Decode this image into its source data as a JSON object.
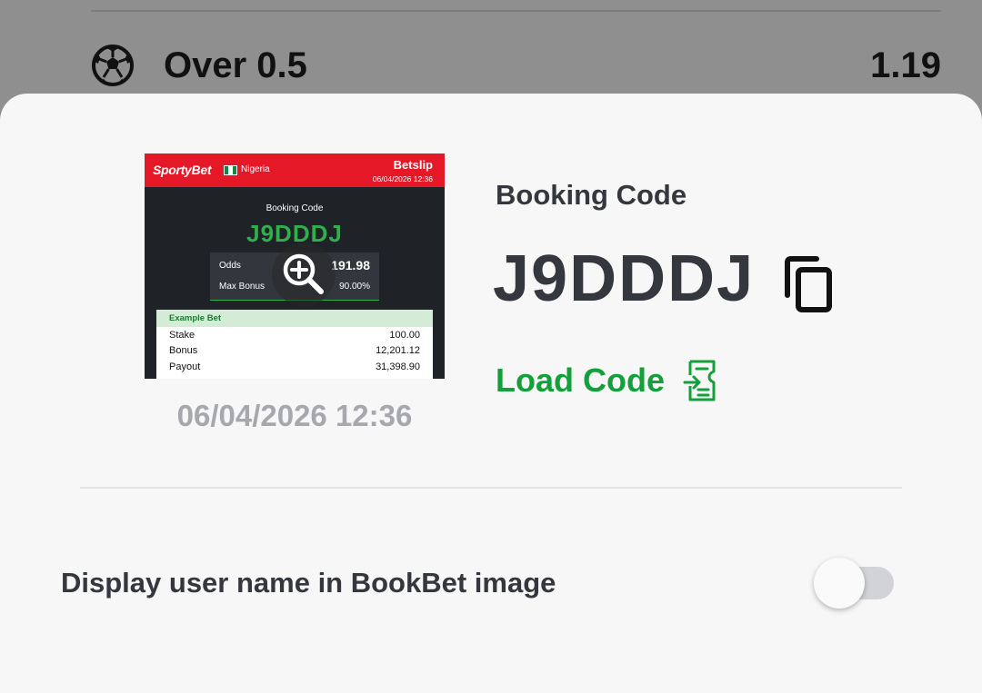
{
  "background_row": {
    "market": "Over 0.5",
    "odds": "1.19",
    "icon": "soccer-ball-icon"
  },
  "thumbnail": {
    "brand": "SportyBet",
    "country": "Nigeria",
    "header_title": "Betslip",
    "header_date": "06/04/2026 12:36",
    "booking_code_label": "Booking Code",
    "code": "J9DDDJ",
    "odds_label": "Odds",
    "odds_value": "191.98",
    "max_bonus_label": "Max Bonus",
    "max_bonus_value": "90.00%",
    "example_bet_label": "Example Bet",
    "rows": [
      {
        "label": "Stake",
        "value": "100.00"
      },
      {
        "label": "Bonus",
        "value": "12,201.12"
      },
      {
        "label": "Payout",
        "value": "31,398.90"
      }
    ],
    "zoom_icon": "zoom-in-icon"
  },
  "sheet": {
    "date": "06/04/2026 12:36",
    "booking_code_label": "Booking Code",
    "booking_code": "J9DDDJ",
    "copy_icon": "copy-icon",
    "load_code_label": "Load Code",
    "load_icon": "ticket-icon",
    "toggle_label": "Display user name in BookBet image",
    "toggle_on": false
  },
  "colors": {
    "accent_green": "#13a03a",
    "brand_red": "#e41827",
    "text_dark": "#34373d",
    "text_muted": "#a7a8ad"
  }
}
